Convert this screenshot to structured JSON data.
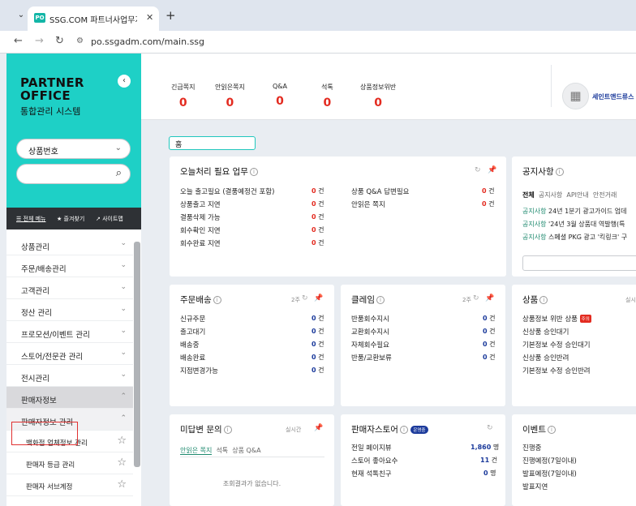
{
  "browser": {
    "tab_favicon": "PO",
    "tab_title": "SSG.COM 파트너사업무지원시",
    "url": "po.ssgadm.com/main.ssg"
  },
  "sidebar": {
    "brand_line1": "PARTNER",
    "brand_line2": "OFFICE",
    "brand_sub": "통합관리 시스템",
    "select_value": "상품번호",
    "tabs": [
      "☰ 전체 메뉴",
      "★ 즐겨찾기",
      "↗ 사이트맵"
    ],
    "items": [
      {
        "label": "상품관리"
      },
      {
        "label": "주문/배송관리"
      },
      {
        "label": "고객관리"
      },
      {
        "label": "정산 관리"
      },
      {
        "label": "프로모션/이벤트 관리"
      },
      {
        "label": "스토어/전문관 관리"
      },
      {
        "label": "전시관리"
      },
      {
        "label": "판매자정보"
      },
      {
        "label": "판매자정보 관리"
      },
      {
        "label": "백화점 업체정보 관리"
      },
      {
        "label": "판매자 등급 관리"
      },
      {
        "label": "판매자 서브계정"
      }
    ]
  },
  "header": {
    "stats": [
      {
        "label": "긴급쪽지",
        "value": "0"
      },
      {
        "label": "안읽은쪽지",
        "value": "0"
      },
      {
        "label": "Q&A",
        "value": "0"
      },
      {
        "label": "석톡",
        "value": "0"
      },
      {
        "label": "상품정보위반",
        "value": "0"
      }
    ],
    "store_name": "세인트앤드류스"
  },
  "home_chip": "홈",
  "today": {
    "title": "오늘처리 필요 업무",
    "left": [
      {
        "label": "오늘 출고필요 (결품예정건 포함)",
        "count": "0",
        "unit": "건"
      },
      {
        "label": "상품출고 지연",
        "count": "0",
        "unit": "건"
      },
      {
        "label": "결품삭제 가능",
        "count": "0",
        "unit": "건"
      },
      {
        "label": "회수확인 지연",
        "count": "0",
        "unit": "건"
      },
      {
        "label": "회수완료 지연",
        "count": "0",
        "unit": "건"
      }
    ],
    "right": [
      {
        "label": "상품 Q&A 답변필요",
        "count": "0",
        "unit": "건"
      },
      {
        "label": "안읽은 쪽지",
        "count": "0",
        "unit": "건"
      }
    ]
  },
  "notice": {
    "title": "공지사항",
    "tabs": [
      "전체",
      "공지사항",
      "API안내",
      "안전거래"
    ],
    "items": [
      {
        "tag": "공지사항",
        "text": "24년 1분기 광고가이드 업데"
      },
      {
        "tag": "공지사항",
        "text": "'24년 3월 상품대 역발행(특"
      },
      {
        "tag": "공지사항",
        "text": "스페셜 PKG 광고 '킥링크' 구"
      }
    ]
  },
  "orders": {
    "title": "주문배송",
    "period": "2주",
    "rows": [
      {
        "label": "신규주문",
        "count": "0",
        "unit": "건"
      },
      {
        "label": "출고대기",
        "count": "0",
        "unit": "건"
      },
      {
        "label": "배송중",
        "count": "0",
        "unit": "건"
      },
      {
        "label": "배송완료",
        "count": "0",
        "unit": "건"
      },
      {
        "label": "지점변경가능",
        "count": "0",
        "unit": "건"
      }
    ]
  },
  "claims": {
    "title": "클레임",
    "period": "2주",
    "rows": [
      {
        "label": "반품회수지시",
        "count": "0",
        "unit": "건"
      },
      {
        "label": "교환회수지시",
        "count": "0",
        "unit": "건"
      },
      {
        "label": "자체회수필요",
        "count": "0",
        "unit": "건"
      },
      {
        "label": "반품/교환보류",
        "count": "0",
        "unit": "건"
      }
    ]
  },
  "products": {
    "title": "상품",
    "period_text": "실시",
    "badge": "주의",
    "rows": [
      {
        "label": "상품정보 위반 상품"
      },
      {
        "label": "신상품 승인대기"
      },
      {
        "label": "기본정보 수정 승인대기"
      },
      {
        "label": "신상품 승인반려"
      },
      {
        "label": "기본정보 수정 승인반려"
      }
    ]
  },
  "unanswered": {
    "title": "미답변 문의",
    "realtime": "실시간",
    "tabs": [
      "안읽은 쪽지",
      "석톡",
      "상품 Q&A"
    ],
    "empty": "조회결과가 없습니다."
  },
  "seller_store": {
    "title": "판매자스토어",
    "badge": "운영중",
    "rows": [
      {
        "label": "전일 페이지뷰",
        "count": "1,860",
        "unit": "명"
      },
      {
        "label": "스토어 좋아요수",
        "count": "11",
        "unit": "건"
      },
      {
        "label": "현재 석톡친구",
        "count": "0",
        "unit": "명"
      }
    ]
  },
  "events": {
    "title": "이벤트",
    "rows": [
      {
        "label": "진행중"
      },
      {
        "label": "진행예정(7일이내)"
      },
      {
        "label": "발표예정(7일이내)"
      },
      {
        "label": "발표지연"
      }
    ]
  }
}
